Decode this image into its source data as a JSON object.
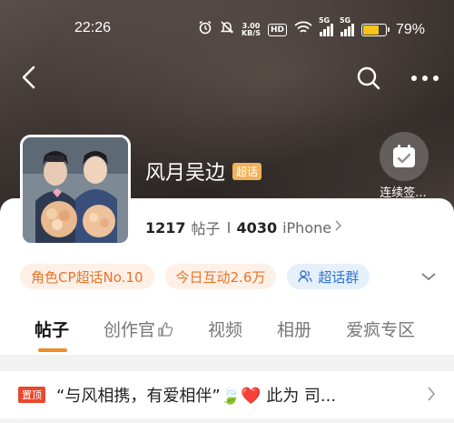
{
  "status_bar": {
    "time": "22:26",
    "net_speed_top": "3.00",
    "net_speed_bottom": "KB/S",
    "hd": "HD",
    "signal1_tag": "5G",
    "signal2_tag": "5G",
    "battery_percent": "79%",
    "battery_level": 0.79
  },
  "nav": {
    "back_icon": "back-icon",
    "search_icon": "search-icon",
    "more_icon": "more-icon"
  },
  "header": {
    "title": "风月吴边",
    "tag": "超话",
    "checkin_label": "连续签..."
  },
  "stats": {
    "posts_count": "1217",
    "posts_label": "帖子",
    "second_count": "4030",
    "second_label": "iPhone"
  },
  "chips": [
    {
      "label": "角色CP超话No.10"
    },
    {
      "label": "今日互动2.6万"
    },
    {
      "label": "超话群"
    }
  ],
  "tabs": [
    {
      "label": "帖子"
    },
    {
      "label": "创作官"
    },
    {
      "label": "视频"
    },
    {
      "label": "相册"
    },
    {
      "label": "爱疯专区"
    }
  ],
  "pinned": {
    "badge": "置顶",
    "text": "“与风相携，有爱相伴”🍃❤️  此为 司..."
  },
  "colors": {
    "accent": "#f08c28",
    "chip_orange": "#e8742a",
    "chip_blue": "#2f76cf",
    "pin_red": "#e8492e",
    "super_tag": "#f0b35a"
  }
}
